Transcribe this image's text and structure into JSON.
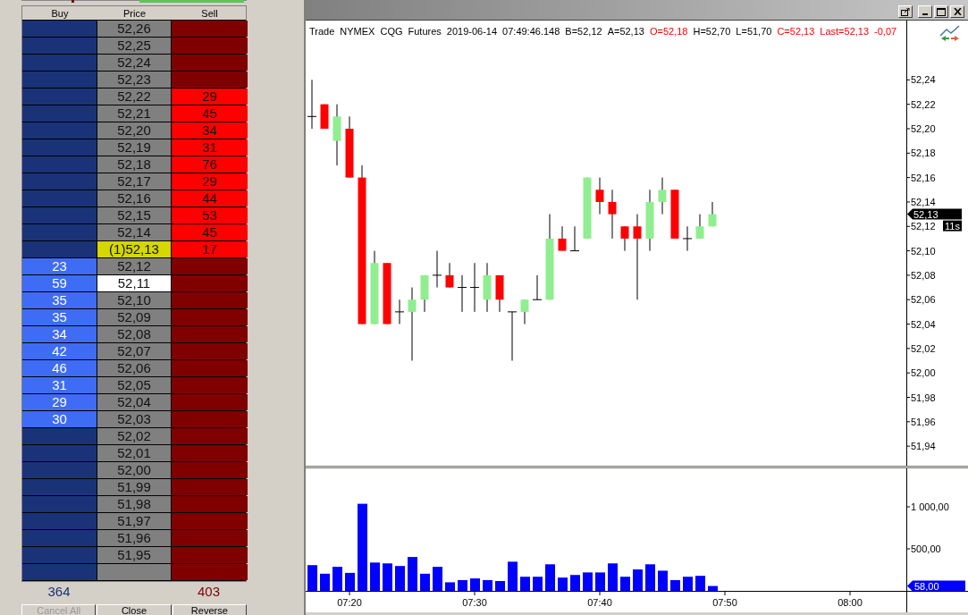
{
  "order_book": {
    "headers": [
      "Buy",
      "Price",
      "Sell"
    ],
    "rows": [
      {
        "price": "52,26",
        "kind": "normal"
      },
      {
        "price": "52,25",
        "kind": "normal"
      },
      {
        "price": "52,24",
        "kind": "normal"
      },
      {
        "price": "52,23",
        "kind": "normal"
      },
      {
        "price": "52,22",
        "sell": "29",
        "kind": "normal"
      },
      {
        "price": "52,21",
        "sell": "45",
        "kind": "normal"
      },
      {
        "price": "52,20",
        "sell": "34",
        "kind": "normal"
      },
      {
        "price": "52,19",
        "sell": "31",
        "kind": "normal"
      },
      {
        "price": "52,18",
        "sell": "76",
        "kind": "normal"
      },
      {
        "price": "52,17",
        "sell": "29",
        "kind": "normal"
      },
      {
        "price": "52,16",
        "sell": "44",
        "kind": "normal"
      },
      {
        "price": "52,15",
        "sell": "53",
        "kind": "normal"
      },
      {
        "price": "52,14",
        "sell": "45",
        "kind": "normal"
      },
      {
        "price": "(1)52,13",
        "sell": "17",
        "kind": "last"
      },
      {
        "price": "52,12",
        "buy": "23",
        "kind": "normal"
      },
      {
        "price": "52,11",
        "buy": "59",
        "kind": "selected"
      },
      {
        "price": "52,10",
        "buy": "35",
        "kind": "normal"
      },
      {
        "price": "52,09",
        "buy": "35",
        "kind": "normal"
      },
      {
        "price": "52,08",
        "buy": "34",
        "kind": "normal"
      },
      {
        "price": "52,07",
        "buy": "42",
        "kind": "normal"
      },
      {
        "price": "52,06",
        "buy": "46",
        "kind": "normal"
      },
      {
        "price": "52,05",
        "buy": "31",
        "kind": "normal"
      },
      {
        "price": "52,04",
        "buy": "29",
        "kind": "normal"
      },
      {
        "price": "52,03",
        "buy": "30",
        "kind": "normal"
      },
      {
        "price": "52,02",
        "kind": "normal"
      },
      {
        "price": "52,01",
        "kind": "normal"
      },
      {
        "price": "52,00",
        "kind": "normal"
      },
      {
        "price": "51,99",
        "kind": "normal"
      },
      {
        "price": "51,98",
        "kind": "normal"
      },
      {
        "price": "51,97",
        "kind": "normal"
      },
      {
        "price": "51,96",
        "kind": "normal"
      },
      {
        "price": "51,95",
        "kind": "normal"
      },
      {
        "kind": "normal"
      }
    ],
    "totals": {
      "buy": "364",
      "sell": "403"
    }
  },
  "buttons": [
    {
      "label": "Cancel All",
      "disabled": true
    },
    {
      "label": "Close",
      "disabled": false
    },
    {
      "label": "Reverse",
      "disabled": false
    }
  ],
  "chart_window": {
    "legend": [
      {
        "text": "Trade",
        "highlight": false
      },
      {
        "text": "NYMEX",
        "highlight": false
      },
      {
        "text": "CQG",
        "highlight": false
      },
      {
        "text": "Futures",
        "highlight": false
      },
      {
        "text": "2019-06-14",
        "highlight": false
      },
      {
        "text": "07:49:46.148",
        "highlight": false
      },
      {
        "text": "B=52,12",
        "highlight": false
      },
      {
        "text": "A=52,13",
        "highlight": false
      },
      {
        "text": "O=52,18",
        "highlight": true
      },
      {
        "text": "H=52,70",
        "highlight": false
      },
      {
        "text": "L=51,70",
        "highlight": false
      },
      {
        "text": "C=52,13",
        "highlight": true
      },
      {
        "text": "Last=52,13",
        "highlight": true
      },
      {
        "text": "-0,07",
        "highlight": true
      }
    ],
    "price_axis": {
      "labels": [
        "52,24",
        "52,22",
        "52,20",
        "52,18",
        "52,16",
        "52,14",
        "52,12",
        "52,10",
        "52,08",
        "52,06",
        "52,04",
        "52,02",
        "52,00",
        "51,98",
        "51,96",
        "51,94"
      ]
    },
    "last_price_tag": "52,13",
    "timer": "11s",
    "volume_axis": {
      "labels": [
        "1 000,00",
        "500,00"
      ]
    },
    "volume_tag": "58,00",
    "time_axis": {
      "labels": [
        "07:20",
        "07:30",
        "07:40",
        "07:50",
        "08:00"
      ]
    }
  }
}
